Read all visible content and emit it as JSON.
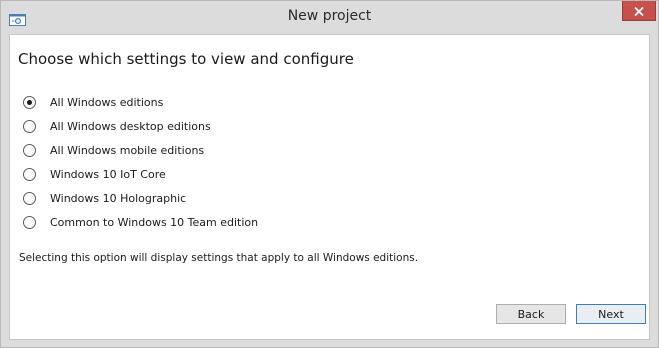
{
  "window": {
    "title": "New project",
    "icon": "project-settings-icon",
    "close_icon": "close-icon"
  },
  "main": {
    "heading": "Choose which settings to view and configure",
    "options": [
      {
        "label": "All Windows editions",
        "selected": true
      },
      {
        "label": "All Windows desktop editions",
        "selected": false
      },
      {
        "label": "All Windows mobile editions",
        "selected": false
      },
      {
        "label": "Windows 10 IoT Core",
        "selected": false
      },
      {
        "label": "Windows 10 Holographic",
        "selected": false
      },
      {
        "label": "Common to Windows 10 Team edition",
        "selected": false
      }
    ],
    "description": "Selecting this option will display settings that apply to all Windows editions."
  },
  "buttons": {
    "back": "Back",
    "next": "Next"
  },
  "colors": {
    "close_button": "#c7504f",
    "window_frame": "#dcdcdc",
    "primary_button_border": "#3c7fb1"
  }
}
